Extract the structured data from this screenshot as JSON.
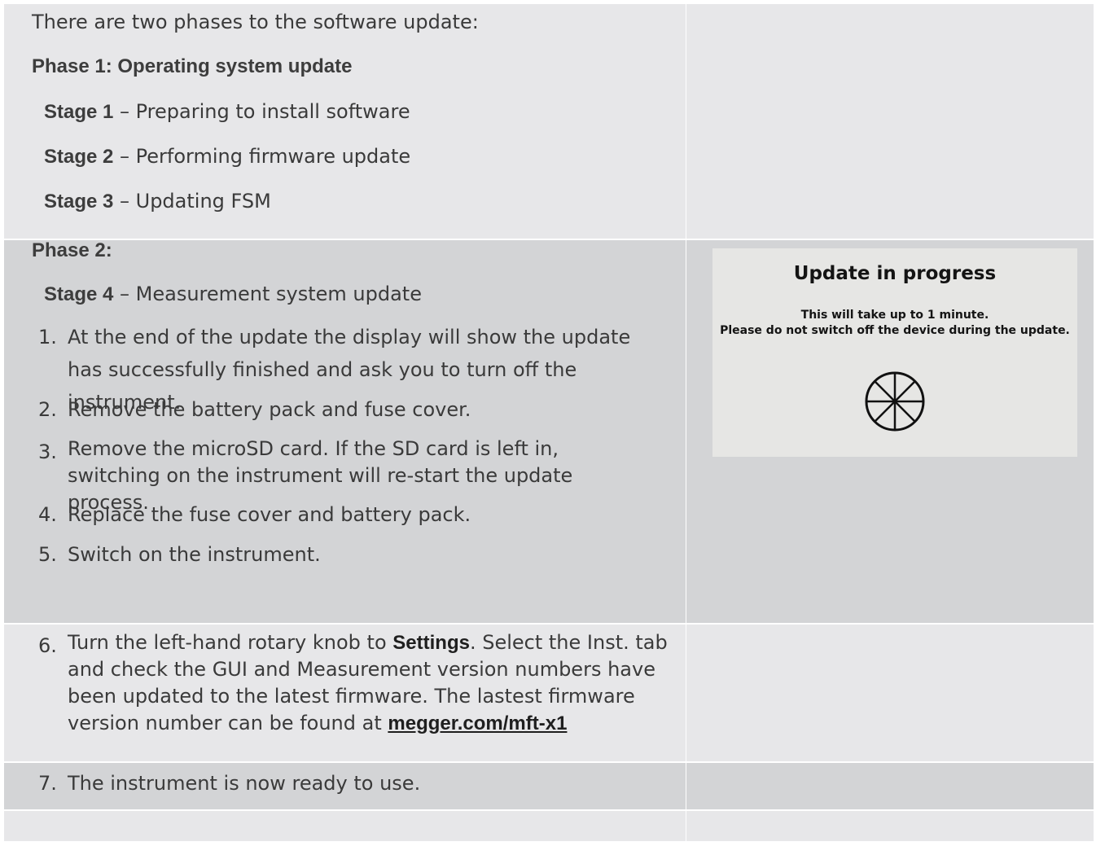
{
  "phase1": {
    "intro": "There are two phases to the software update:",
    "heading": "Phase 1: Operating system update",
    "stages": [
      {
        "label": "Stage 1",
        "text": " – Preparing to install software"
      },
      {
        "label": "Stage 2",
        "text": " – Performing firmware update"
      },
      {
        "label": "Stage 3",
        "text": " – Updating FSM"
      }
    ]
  },
  "phase2": {
    "heading": "Phase 2:",
    "stage": {
      "label": "Stage 4",
      "text": " – Measurement system update"
    },
    "steps": [
      {
        "num": "1.",
        "text": "At the end of the update the display will show the update has successfully finished and ask you to turn off the instrument."
      },
      {
        "num": "2.",
        "text": "Remove the battery pack and fuse cover."
      },
      {
        "num": "3.",
        "text": "Remove the microSD card. If the SD card is left in, switching on the instrument will re-start the update process."
      },
      {
        "num": "4.",
        "text": "Replace the fuse cover and battery pack."
      },
      {
        "num": "5.",
        "text": "Switch on the instrument."
      }
    ]
  },
  "screen": {
    "title": "Update in progress",
    "line1": "This will take up to 1 minute.",
    "line2": "Please do not switch off the device during the update.",
    "spinner_icon": "spinner-icon"
  },
  "step6": {
    "num": "6.",
    "text_before": "Turn the left-hand rotary knob to ",
    "bold": "Settings",
    "text_after": ". Select the Inst. tab and check the GUI and Measurement version numbers have been updated to the latest firmware. The lastest firmware version number can be found at ",
    "link": "megger.com/mft-x1"
  },
  "step7": {
    "num": "7.",
    "text": "The instrument is now ready to use."
  },
  "colors": {
    "light_row": "#e7e7e9",
    "dark_row": "#d3d4d6",
    "text": "#3a3a3a"
  }
}
